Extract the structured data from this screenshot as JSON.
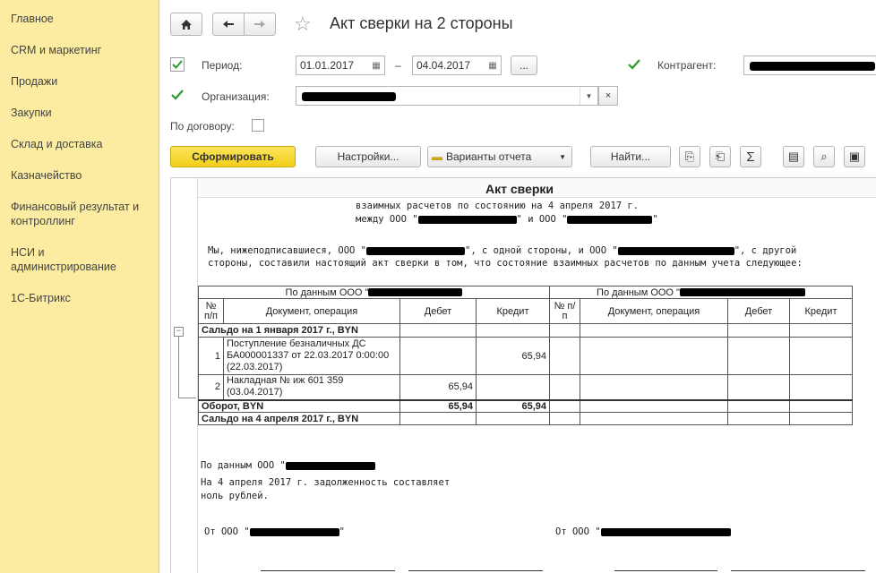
{
  "sidebar": {
    "items": [
      {
        "label": "Главное"
      },
      {
        "label": "CRM и маркетинг"
      },
      {
        "label": "Продажи"
      },
      {
        "label": "Закупки"
      },
      {
        "label": "Склад и доставка"
      },
      {
        "label": "Казначейство"
      },
      {
        "label": "Финансовый результат и контроллинг"
      },
      {
        "label": "НСИ и администрирование"
      },
      {
        "label": "1С-Битрикс"
      }
    ]
  },
  "header": {
    "title": "Акт сверки на 2 стороны"
  },
  "form": {
    "period_label": "Период:",
    "date_from": "01.01.2017",
    "dash": "–",
    "date_to": "04.04.2017",
    "ellipsis": "...",
    "counterparty_label": "Контрагент:",
    "organization_label": "Организация:",
    "contract_label": "По договору:"
  },
  "toolbar": {
    "generate": "Сформировать",
    "settings": "Настройки...",
    "variants": "Варианты отчета",
    "find": "Найти...",
    "sum": "Σ"
  },
  "report": {
    "title": "Акт сверки",
    "subtitle": "взаимных расчетов по состоянию на 4 апреля 2017 г.",
    "between_a": "между ООО \"",
    "between_b": "\" и ООО \"",
    "between_c": "\"",
    "para_a": "Мы, нижеподписавшиеся,  ООО \"",
    "para_b": "\", с одной стороны, и  ООО \"",
    "para_c": "\", с другой",
    "para_line2": "стороны, составили настоящий акт сверки в том, что состояние взаимных расчетов по данным учета следующее:",
    "left_header": "По данным ООО \"",
    "right_header": "По данным ООО \"",
    "col_num": "№ п/п",
    "col_doc": "Документ, операция",
    "col_debit": "Дебет",
    "col_credit": "Кредит",
    "opening": "Сальдо на 1 января 2017 г., BYN",
    "rows": [
      {
        "num": "1",
        "doc": "Поступление безналичных ДС БА000001337 от 22.03.2017 0:00:00 (22.03.2017)",
        "debit": "",
        "credit": "65,94"
      },
      {
        "num": "2",
        "doc": "Накладная №  иж 601 359 (03.04.2017)",
        "debit": "65,94",
        "credit": ""
      }
    ],
    "turnover": "Оборот, BYN",
    "turnover_debit": "65,94",
    "turnover_credit": "65,94",
    "closing": "Сальдо на 4 апреля 2017 г., BYN",
    "by_data": "По данным  ООО \"",
    "debt_line1": "На 4 апреля 2017 г. задолженность  составляет",
    "debt_line2": "ноль  рублей.",
    "from_left": "От ООО \"",
    "from_left_end": "\"",
    "from_right": "От  ООО \""
  }
}
